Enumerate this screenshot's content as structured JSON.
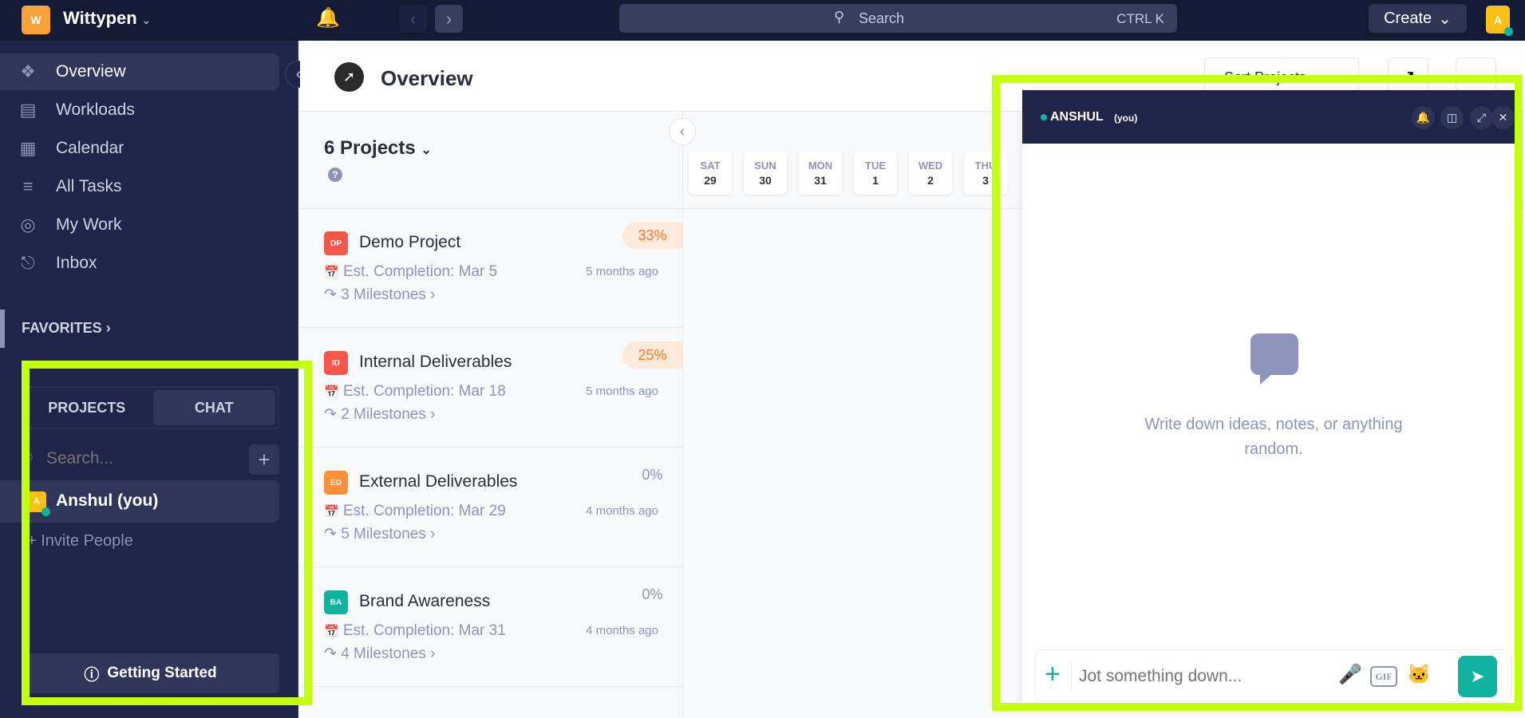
{
  "topbar": {
    "workspace_initial": "W",
    "workspace_name": "Wittypen",
    "search_label": "Search",
    "search_shortcut": "CTRL K",
    "create_label": "Create",
    "avatar_initial": "A",
    "accent": "#f9a23a"
  },
  "sidebar": {
    "items": [
      {
        "label": "Overview",
        "icon": "compass-icon"
      },
      {
        "label": "Workloads",
        "icon": "bar-chart-icon"
      },
      {
        "label": "Calendar",
        "icon": "calendar-icon"
      },
      {
        "label": "All Tasks",
        "icon": "checklist-icon"
      },
      {
        "label": "My Work",
        "icon": "user-target-icon"
      },
      {
        "label": "Inbox",
        "icon": "bell-icon"
      }
    ],
    "favorites_label": "FAVORITES",
    "tabs": [
      {
        "label": "PROJECTS"
      },
      {
        "label": "CHAT"
      }
    ],
    "search_placeholder": "Search...",
    "chat_user": {
      "initial": "A",
      "name": "Anshul (you)"
    },
    "invite_label": "+ Invite People",
    "getting_started_label": "Getting Started"
  },
  "main": {
    "title": "Overview",
    "projects_count_label": "6 Projects",
    "sort_label": "Sort Projects",
    "dates": [
      {
        "day": "SAT",
        "num": "29"
      },
      {
        "day": "SUN",
        "num": "30"
      },
      {
        "day": "MON",
        "num": "31"
      },
      {
        "day": "TUE",
        "num": "1"
      },
      {
        "day": "WED",
        "num": "2"
      },
      {
        "day": "THU",
        "num": "3"
      }
    ],
    "projects": [
      {
        "initials": "DP",
        "name": "Demo Project",
        "completion": "Est. Completion: Mar 5",
        "milestones": "3 Milestones",
        "updated": "5 months ago",
        "progress": "33%",
        "color": "#f4574a"
      },
      {
        "initials": "ID",
        "name": "Internal Deliverables",
        "completion": "Est. Completion: Mar 18",
        "milestones": "2 Milestones",
        "updated": "5 months ago",
        "progress": "25%",
        "color": "#f4574a"
      },
      {
        "initials": "ED",
        "name": "External Deliverables",
        "completion": "Est. Completion: Mar 29",
        "milestones": "5 Milestones",
        "updated": "4 months ago",
        "progress": "0%",
        "color": "#f98f3a"
      },
      {
        "initials": "BA",
        "name": "Brand Awareness",
        "completion": "Est. Completion: Mar 31",
        "milestones": "4 Milestones",
        "updated": "4 months ago",
        "progress": "0%",
        "color": "#10b3a0"
      }
    ]
  },
  "chat": {
    "user": "ANSHUL",
    "you": "(you)",
    "empty_text": "Write down ideas, notes, or anything random.",
    "input_placeholder": "Jot something down...",
    "gif_label": "GIF",
    "send_color": "#10b3a0"
  }
}
